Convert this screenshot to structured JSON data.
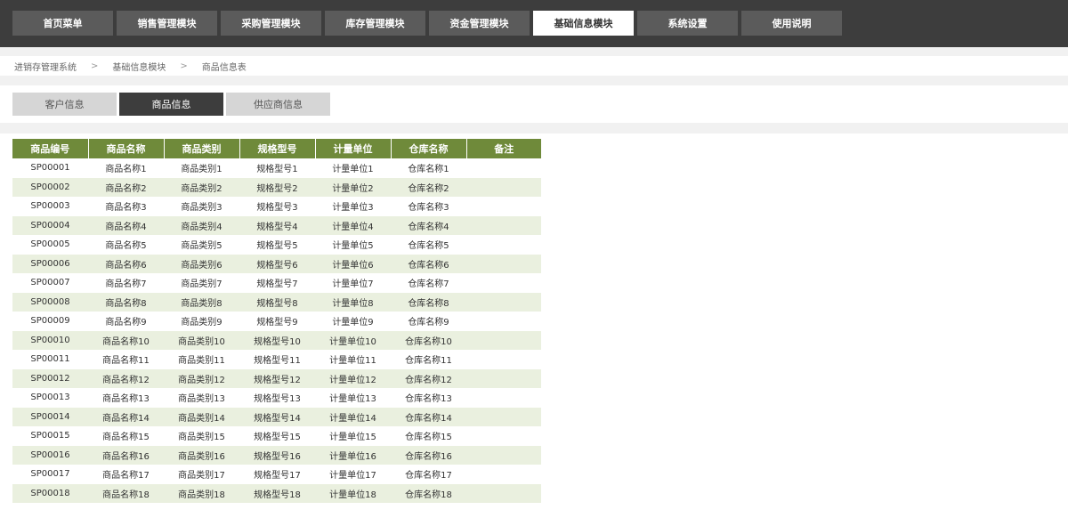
{
  "nav": {
    "items": [
      "首页菜单",
      "销售管理模块",
      "采购管理模块",
      "库存管理模块",
      "资金管理模块",
      "基础信息模块",
      "系统设置",
      "使用说明"
    ],
    "active_index": 5
  },
  "breadcrumb": {
    "items": [
      "进销存管理系统",
      "基础信息模块",
      "商品信息表"
    ],
    "separator": ">"
  },
  "tabs": {
    "items": [
      "客户信息",
      "商品信息",
      "供应商信息"
    ],
    "active_index": 1
  },
  "table": {
    "headers": [
      "商品编号",
      "商品名称",
      "商品类别",
      "规格型号",
      "计量单位",
      "仓库名称",
      "备注"
    ],
    "rows": [
      [
        "SP00001",
        "商品名称1",
        "商品类别1",
        "规格型号1",
        "计量单位1",
        "仓库名称1",
        ""
      ],
      [
        "SP00002",
        "商品名称2",
        "商品类别2",
        "规格型号2",
        "计量单位2",
        "仓库名称2",
        ""
      ],
      [
        "SP00003",
        "商品名称3",
        "商品类别3",
        "规格型号3",
        "计量单位3",
        "仓库名称3",
        ""
      ],
      [
        "SP00004",
        "商品名称4",
        "商品类别4",
        "规格型号4",
        "计量单位4",
        "仓库名称4",
        ""
      ],
      [
        "SP00005",
        "商品名称5",
        "商品类别5",
        "规格型号5",
        "计量单位5",
        "仓库名称5",
        ""
      ],
      [
        "SP00006",
        "商品名称6",
        "商品类别6",
        "规格型号6",
        "计量单位6",
        "仓库名称6",
        ""
      ],
      [
        "SP00007",
        "商品名称7",
        "商品类别7",
        "规格型号7",
        "计量单位7",
        "仓库名称7",
        ""
      ],
      [
        "SP00008",
        "商品名称8",
        "商品类别8",
        "规格型号8",
        "计量单位8",
        "仓库名称8",
        ""
      ],
      [
        "SP00009",
        "商品名称9",
        "商品类别9",
        "规格型号9",
        "计量单位9",
        "仓库名称9",
        ""
      ],
      [
        "SP00010",
        "商品名称10",
        "商品类别10",
        "规格型号10",
        "计量单位10",
        "仓库名称10",
        ""
      ],
      [
        "SP00011",
        "商品名称11",
        "商品类别11",
        "规格型号11",
        "计量单位11",
        "仓库名称11",
        ""
      ],
      [
        "SP00012",
        "商品名称12",
        "商品类别12",
        "规格型号12",
        "计量单位12",
        "仓库名称12",
        ""
      ],
      [
        "SP00013",
        "商品名称13",
        "商品类别13",
        "规格型号13",
        "计量单位13",
        "仓库名称13",
        ""
      ],
      [
        "SP00014",
        "商品名称14",
        "商品类别14",
        "规格型号14",
        "计量单位14",
        "仓库名称14",
        ""
      ],
      [
        "SP00015",
        "商品名称15",
        "商品类别15",
        "规格型号15",
        "计量单位15",
        "仓库名称15",
        ""
      ],
      [
        "SP00016",
        "商品名称16",
        "商品类别16",
        "规格型号16",
        "计量单位16",
        "仓库名称16",
        ""
      ],
      [
        "SP00017",
        "商品名称17",
        "商品类别17",
        "规格型号17",
        "计量单位17",
        "仓库名称17",
        ""
      ],
      [
        "SP00018",
        "商品名称18",
        "商品类别18",
        "规格型号18",
        "计量单位18",
        "仓库名称18",
        ""
      ]
    ]
  },
  "colors": {
    "topbar": "#3d3d3d",
    "nav_item": "#5b5b5b",
    "nav_active": "#ffffff",
    "tab_active": "#3d3d3d",
    "tab_inactive": "#d6d6d6",
    "table_header": "#6f8a3a",
    "row_alt": "#eaf0df"
  }
}
